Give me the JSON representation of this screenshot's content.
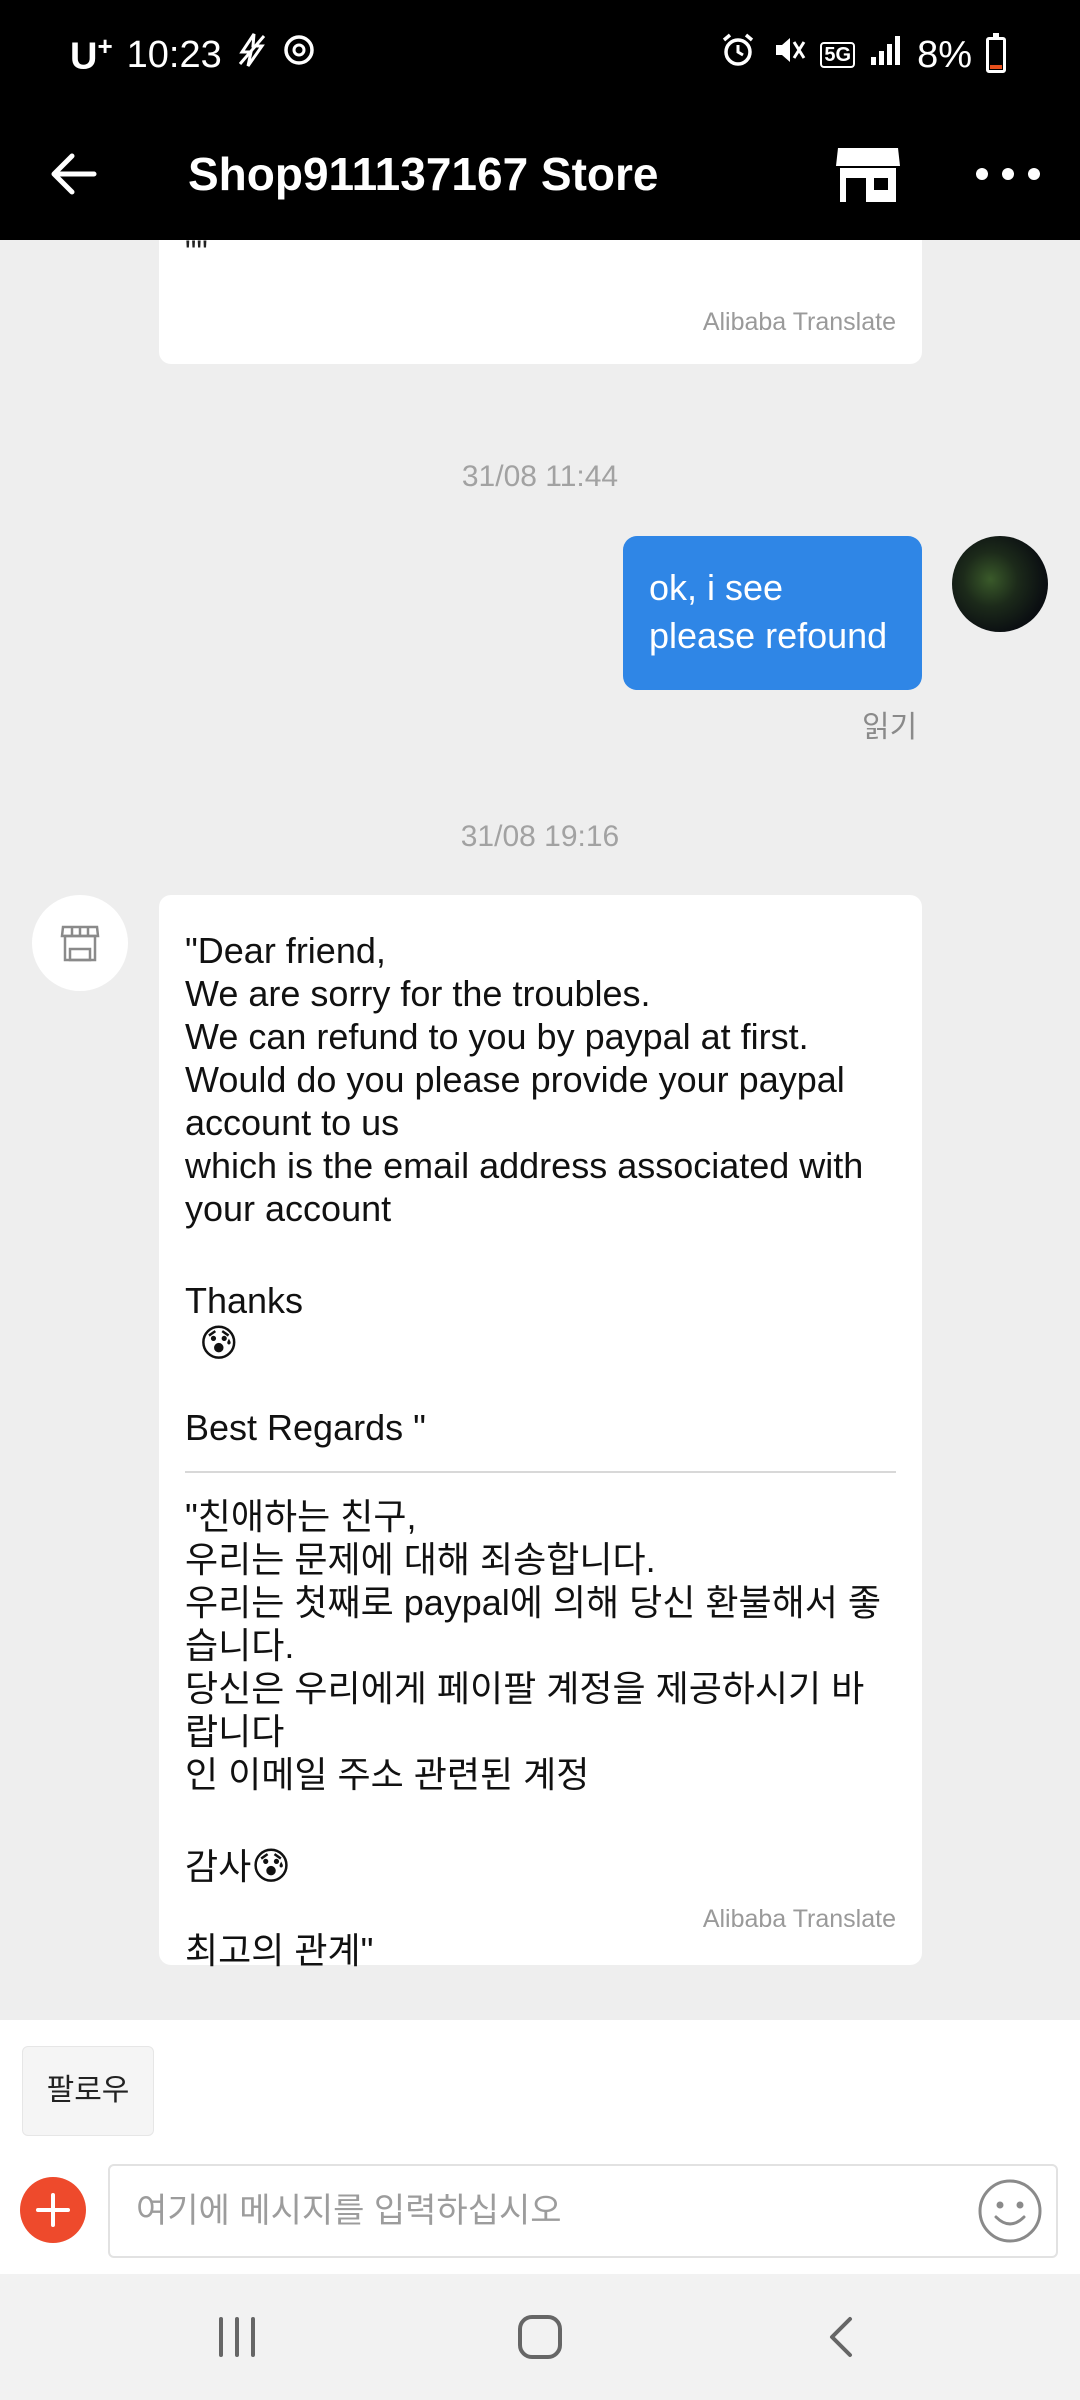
{
  "status_bar": {
    "carrier": "U",
    "carrier_plus": "+",
    "time": "10:23",
    "network": "5G",
    "battery_percent": "8%",
    "battery_level": 0.08,
    "battery_color": "#e8501c"
  },
  "header": {
    "title": "Shop911137167 Store",
    "back_icon": "back-arrow-icon",
    "store_icon": "store-icon",
    "more_icon": "more-dots-icon"
  },
  "chat": {
    "top_message": {
      "partial_text": "\"\"",
      "translate_label": "Alibaba Translate"
    },
    "timestamp_1": "31/08 11:44",
    "outgoing_message": {
      "text": "ok,  i see\nplease refound",
      "read_status": "읽기",
      "bubble_color": "#2f86e6"
    },
    "timestamp_2": "31/08 19:16",
    "incoming_message": {
      "original_text": "\"Dear friend,\nWe are sorry for the troubles.\nWe can refund to you by paypal at first.\nWould do you please provide your paypal account to us\nwhich is the email address associated with your account",
      "thanks_text": "Thanks",
      "regards_text": "Best Regards \"",
      "translated_text": "\"친애하는 친구,\n우리는 문제에 대해 죄송합니다.\n우리는 첫째로 paypal에 의해 당신 환불해서 좋습니다.\n당신은 우리에게 페이팔 계정을 제공하시기 바랍니다\n인 이메일 주소 관련된 계정",
      "translated_thanks": "감사",
      "translated_regards": "최고의 관계\"",
      "emoji": "😰",
      "translate_label": "Alibaba Translate"
    }
  },
  "bottom": {
    "follow_label": "팔로우",
    "input_placeholder": "여기에 메시지를 입력하십시오",
    "input_value": "",
    "add_icon": "plus-icon",
    "emoji_icon": "smiley-icon"
  },
  "nav": {
    "recents_icon": "recents-icon",
    "home_icon": "home-icon",
    "back_icon": "nav-back-icon"
  }
}
